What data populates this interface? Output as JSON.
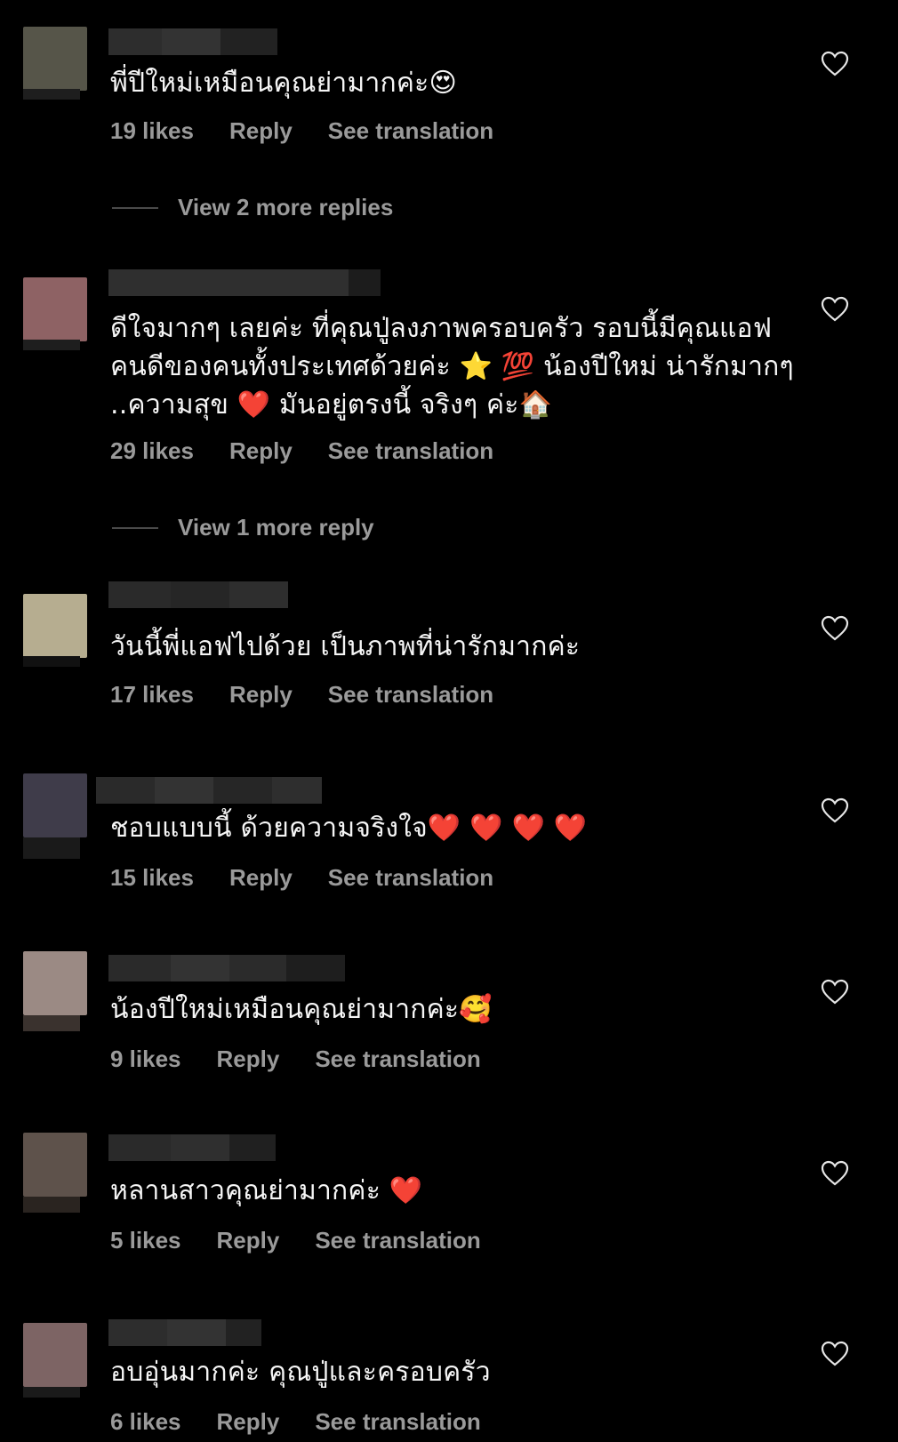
{
  "comments": [
    {
      "text": "พี่ปีใหม่เหมือนคุณย่ามากค่ะ😍",
      "likes": "19 likes",
      "reply": "Reply",
      "translate": "See translation",
      "avatar_color": "#565549",
      "view_more": "View 2 more replies"
    },
    {
      "text": "ดีใจมากๆ เลยค่ะ ที่คุณปู่ลงภาพครอบครัว รอบนี้มีคุณแอฟ คนดีของคนทั้งประเทศด้วยค่ะ ⭐ 💯 น้องปีใหม่ น่ารักมากๆ ..ความสุข ❤️ มันอยู่ตรงนี้ จริงๆ ค่ะ🏠",
      "likes": "29 likes",
      "reply": "Reply",
      "translate": "See translation",
      "avatar_color": "#8e6264",
      "view_more": "View 1 more reply"
    },
    {
      "text": "วันนี้พี่แอฟไปด้วย เป็นภาพที่น่ารักมากค่ะ",
      "likes": "17 likes",
      "reply": "Reply",
      "translate": "See translation",
      "avatar_color": "#b6ad90"
    },
    {
      "text": "ชอบแบบนี้ ด้วยความจริงใจ❤️ ❤️ ❤️ ❤️",
      "likes": "15 likes",
      "reply": "Reply",
      "translate": "See translation",
      "avatar_color": "#3f3c4a"
    },
    {
      "text": "น้องปีใหม่เหมือนคุณย่ามากค่ะ🥰",
      "likes": "9 likes",
      "reply": "Reply",
      "translate": "See translation",
      "avatar_color": "#9b8a84"
    },
    {
      "text": "หลานสาวคุณย่ามากค่ะ ❤️",
      "likes": "5 likes",
      "reply": "Reply",
      "translate": "See translation",
      "avatar_color": "#5e524b"
    },
    {
      "text": "อบอุ่นมากค่ะ คุณปู่และครอบครัว",
      "likes": "6 likes",
      "reply": "Reply",
      "translate": "See translation",
      "avatar_color": "#7d6464"
    }
  ],
  "icons": {
    "like": "heart-outline-icon"
  }
}
